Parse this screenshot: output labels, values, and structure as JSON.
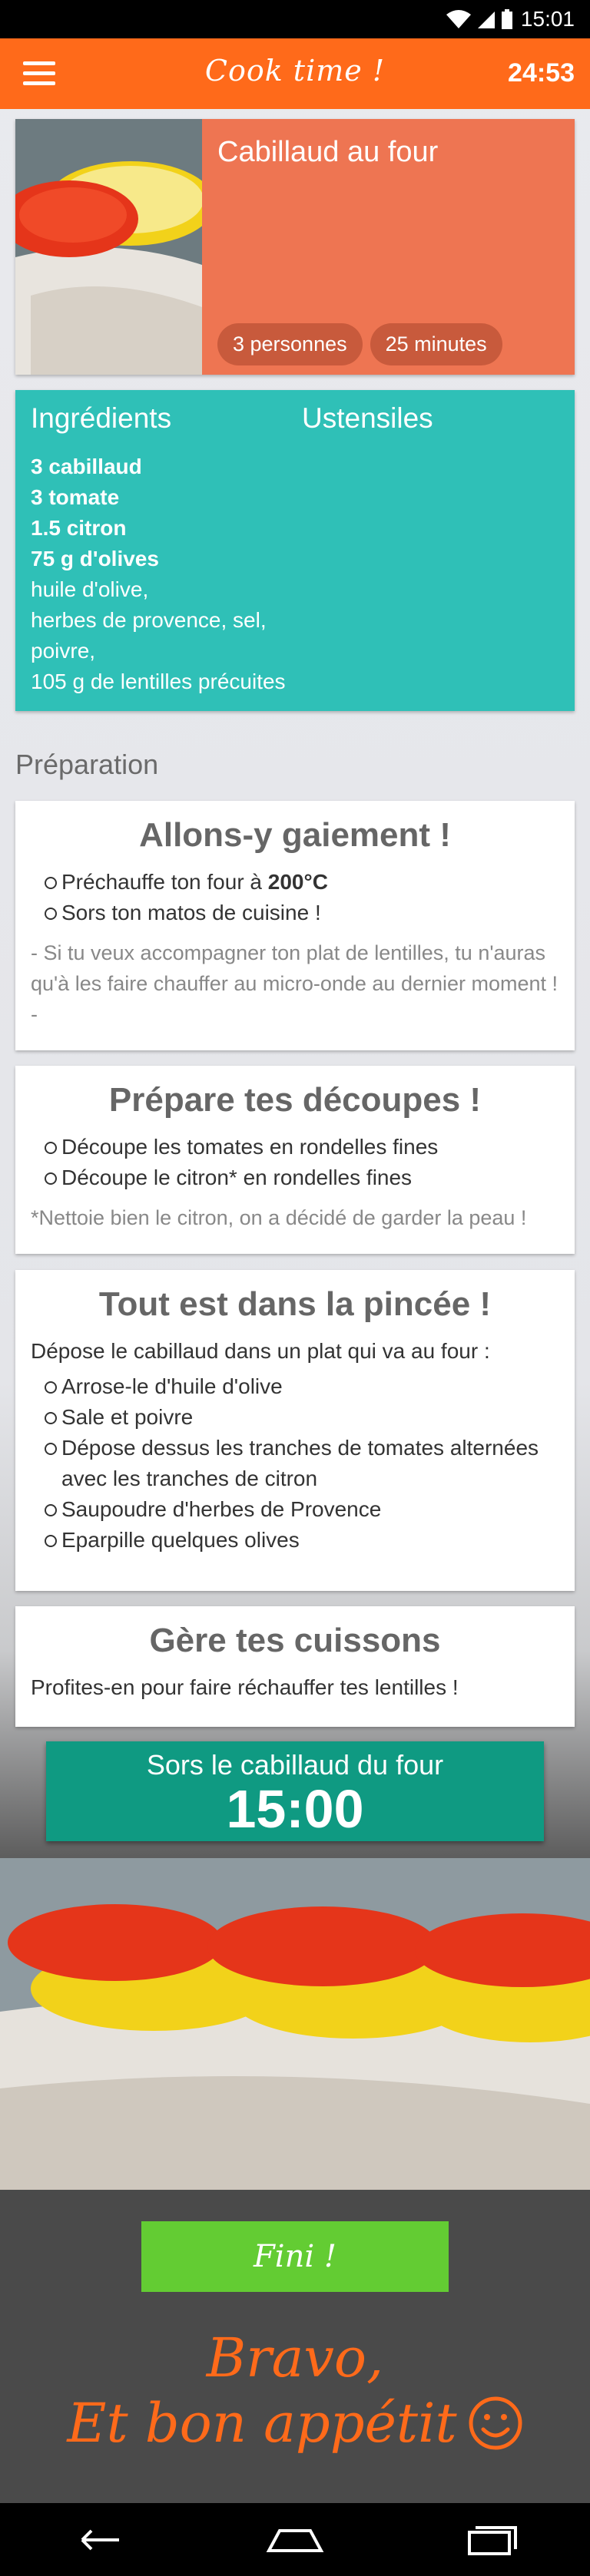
{
  "status_bar": {
    "time": "15:01"
  },
  "app_bar": {
    "title": "Cook time !",
    "timer": "24:53"
  },
  "recipe": {
    "name": "Cabillaud au four",
    "servings": "3 personnes",
    "duration": "25 minutes"
  },
  "tabs": {
    "ingredients": "Ingrédients",
    "utensils": "Ustensiles"
  },
  "ingredients": [
    "3 cabillaud",
    "3 tomate",
    "1.5 citron",
    "75 g d'olives",
    "huile d'olive,",
    "herbes de provence,  sel,",
    "poivre,",
    "105 g de lentilles précuites"
  ],
  "preparation_title": "Préparation",
  "steps": [
    {
      "title": "Allons-y gaiement !",
      "items": [
        "Préchauffe ton four à ",
        "200°C",
        "Sors ton matos de cuisine !"
      ],
      "note": "- Si tu veux accompagner ton plat de lentilles, tu n'auras qu'à les faire chauffer au micro-onde au dernier moment ! -"
    },
    {
      "title": "Prépare tes découpes !",
      "items": [
        "Découpe les tomates en rondelles fines",
        "Découpe le citron* en rondelles fines"
      ],
      "note": "*Nettoie bien le citron, on a décidé de garder la peau !"
    },
    {
      "title": "Tout est dans la pincée !",
      "intro": "Dépose le cabillaud dans un plat qui va au four :",
      "items": [
        "Arrose-le d'huile d'olive",
        "Sale et poivre",
        "Dépose dessus les tranches de tomates alternées avec les tranches de citron",
        "Saupoudre d'herbes de Provence",
        "Eparpille quelques olives"
      ]
    },
    {
      "title": "Gère tes cuissons",
      "intro": "Profites-en pour faire réchauffer tes lentilles !"
    }
  ],
  "timer_block": {
    "label": "Sors le cabillaud du four",
    "time": "15:00"
  },
  "done_button": "Fini !",
  "final_message": {
    "line1": "Bravo,",
    "line2": "Et bon appétit"
  },
  "colors": {
    "accent": "#ff6a1a",
    "teal": "#2fc0b7",
    "salmon": "#ee7552",
    "green": "#63cc33",
    "timer_green": "#0f9a82"
  }
}
